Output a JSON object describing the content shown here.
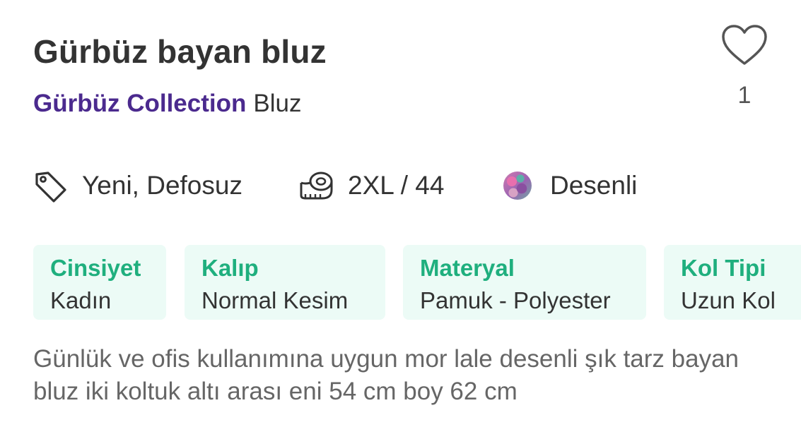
{
  "product": {
    "title": "Gürbüz bayan bluz",
    "brand": "Gürbüz Collection",
    "category": "Bluz"
  },
  "like": {
    "icon": "heart-outline-icon",
    "count": "1"
  },
  "attributes": [
    {
      "icon": "tag-icon",
      "text": "Yeni, Defosuz"
    },
    {
      "icon": "measuring-tape-icon",
      "text": "2XL / 44"
    },
    {
      "icon": "color-swatch-icon",
      "text": "Desenli"
    }
  ],
  "specs": [
    {
      "label": "Cinsiyet",
      "value": "Kadın"
    },
    {
      "label": "Kalıp",
      "value": "Normal Kesim"
    },
    {
      "label": "Materyal",
      "value": "Pamuk - Polyester"
    },
    {
      "label": "Kol Tipi",
      "value": "Uzun Kol"
    }
  ],
  "description": "Günlük ve ofis kullanımına uygun mor lale desenli şık tarz bayan bluz iki koltuk altı arası eni 54 cm boy 62 cm",
  "colors": {
    "text": "#333333",
    "brand": "#4b2a8e",
    "spec_label": "#1faf7e",
    "spec_bg": "#ecfbf6",
    "description": "#666666"
  }
}
